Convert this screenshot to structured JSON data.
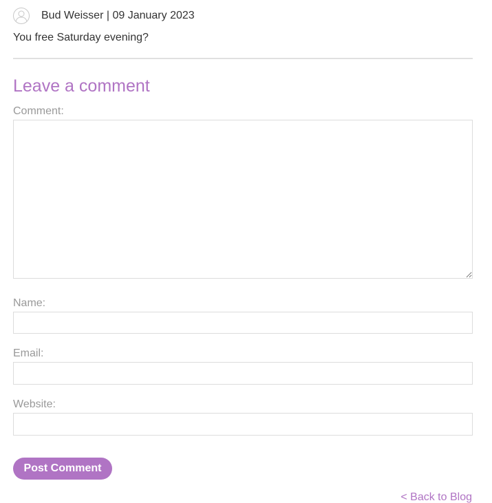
{
  "comment": {
    "author": "Bud Weisser",
    "separator": " | ",
    "date": "09 January 2023",
    "body": "You free Saturday evening?",
    "avatar_icon": "user-avatar-icon"
  },
  "form": {
    "title": "Leave a comment",
    "comment_label": "Comment:",
    "comment_value": "",
    "name_label": "Name:",
    "name_value": "",
    "email_label": "Email:",
    "email_value": "",
    "website_label": "Website:",
    "website_value": "",
    "submit_label": "Post Comment"
  },
  "nav": {
    "back_label": "< Back to Blog"
  },
  "colors": {
    "accent": "#b074c4",
    "label": "#999999",
    "text": "#333333",
    "border": "#dcdcdc"
  }
}
